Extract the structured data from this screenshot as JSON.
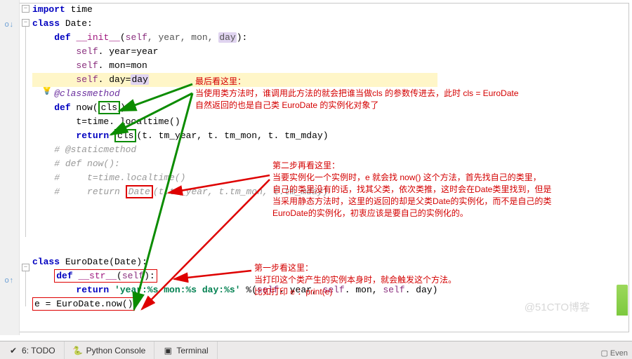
{
  "code": {
    "l1": "import",
    "l1b": " time",
    "l2a": "class",
    "l2b": " Date:",
    "l3a": "def",
    "l3b": "__init__",
    "l3c": "(",
    "l3self": "self",
    "l3d": ", year, mon, ",
    "l3day": "day",
    "l3e": "):",
    "l4a": "self",
    "l4b": ". year=year",
    "l5a": "self",
    "l5b": ". mon=mon",
    "l6a": "self",
    "l6b": ". day=",
    "l6day": "day",
    "l7": "@classmethod",
    "l8a": "def",
    "l8b": " now(",
    "l8cls": "cls",
    "l8c": "):",
    "l9": "t=time. localtime()",
    "l10a": "return",
    "l10cls": "cls",
    "l10b": "(t. tm_year, t. tm_mon, t. tm_mday)",
    "l11": "# @staticmethod",
    "l12": "# def now():",
    "l13": "#     t=time.localtime()",
    "l14a": "#     return ",
    "l14date": "Date",
    "l14b": "(t.tm_year, t.tm_mon, t.tm_mday)",
    "blank": "",
    "l16a": "class",
    "l16b": " EuroDate(Date):",
    "l17a": "def",
    "l17b": "__str__",
    "l17c": "(",
    "l17self": "self",
    "l17d": "):",
    "l18a": "return",
    "l18b": "'year:%s mon:%s day:%s'",
    "l18c": " %(",
    "l18s1": "self",
    "l18d": ". year, ",
    "l18s2": "self",
    "l18e": ". mon, ",
    "l18s3": "self",
    "l18f": ". day)",
    "l19": "e = EuroDate.now()"
  },
  "anno1": {
    "title": "最后看这里：",
    "l1": "当使用类方法时，谁调用此方法的就会把谁当做cls 的参数传进去，此时 cls = EuroDate",
    "l2": "自然返回的也是自己类 EuroDate 的实例化对象了"
  },
  "anno2": {
    "title": "第二步再看这里：",
    "l1": "当要实例化一个实例时，e 就会找 now() 这个方法，首先找自己的类里，",
    "l2": "自己的类里没有的话，找其父类，依次类推，这时会在Date类里找到，但是",
    "l3": "当采用静态方法时，这里的返回的却是父类Date的实例化，而不是自己的类",
    "l4": "EuroDate的实例化，初衷应该是要自己的实例化的。"
  },
  "anno3": {
    "title": "第一步看这里：",
    "l1": "当打印这个类产生的实例本身时，就会触发这个方法。",
    "l2": "比如打印 e ：print(e)"
  },
  "tabs": {
    "todo": "6: TODO",
    "console": "Python Console",
    "terminal": "Terminal"
  },
  "watermark": "@51CTO博客",
  "even": "Even"
}
